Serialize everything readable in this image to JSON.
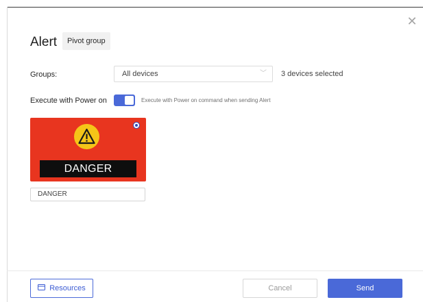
{
  "dialog": {
    "title": "Alert",
    "pivot_label": "Pivot group",
    "close_icon": "close-icon"
  },
  "groups": {
    "label": "Groups:",
    "selected": "All devices",
    "selected_count": "3 devices selected"
  },
  "power": {
    "label": "Execute with Power on",
    "enabled": true,
    "hint": "Execute with Power on command when sending Alert"
  },
  "card": {
    "banner_text": "DANGER",
    "icon": "warning-triangle-icon",
    "selected": true,
    "bg_color": "#e8351f",
    "icon_color": "#f5c518"
  },
  "name_field": {
    "value": "DANGER"
  },
  "footer": {
    "resources_label": "Resources",
    "cancel_label": "Cancel",
    "send_label": "Send"
  },
  "colors": {
    "accent": "#4a69d8"
  }
}
